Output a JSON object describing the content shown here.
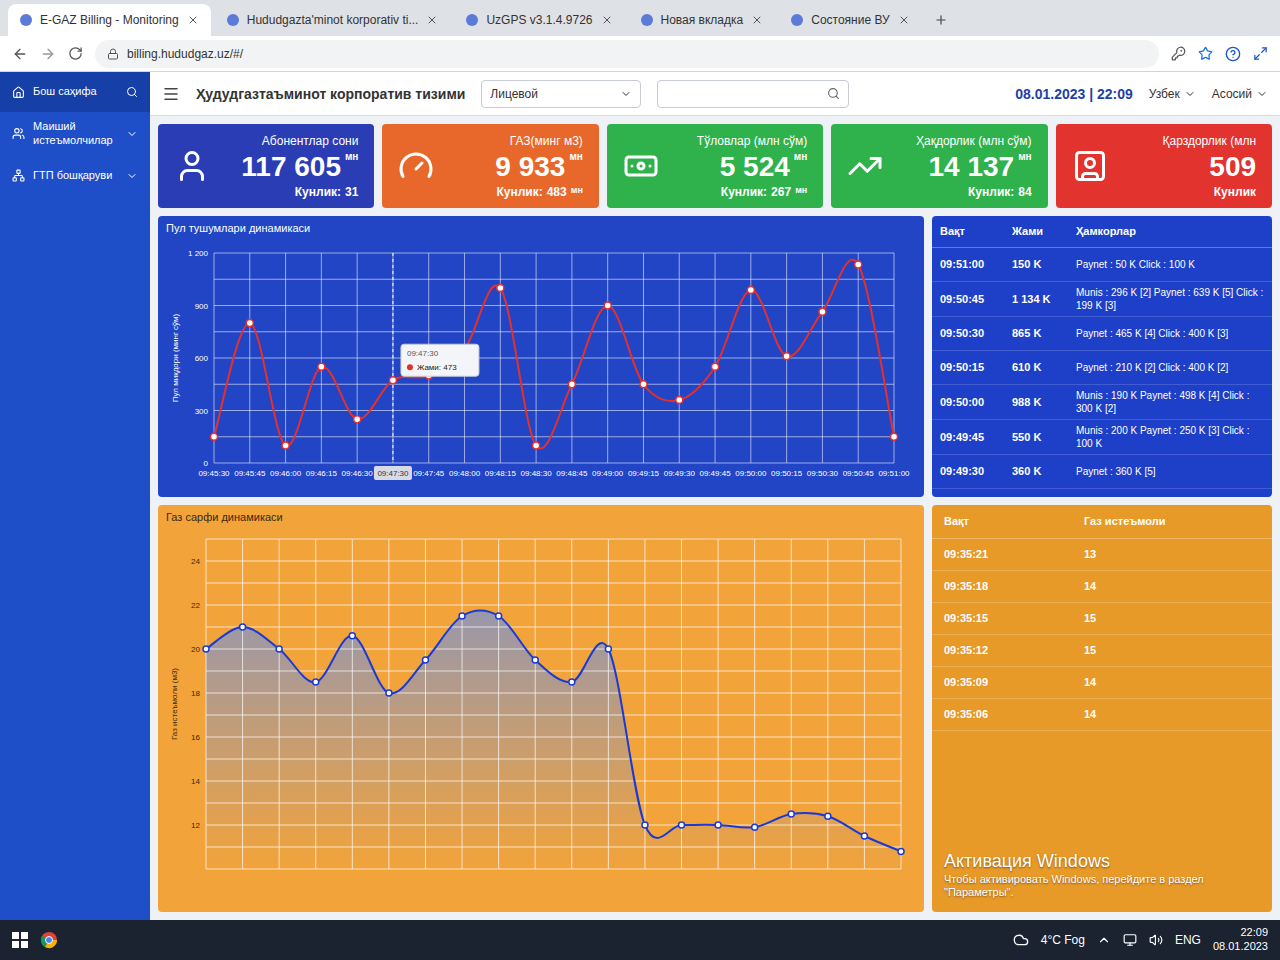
{
  "browser": {
    "tabs": [
      {
        "label": "E-GAZ Billing - Monitoring",
        "selected": true
      },
      {
        "label": "Hududgazta'minot korporativ ti...",
        "selected": false
      },
      {
        "label": "UzGPS v3.1.4.9726",
        "selected": false
      },
      {
        "label": "Новая вкладка",
        "selected": false
      },
      {
        "label": "Состояние ВУ",
        "selected": false
      }
    ],
    "address": "billing.hududgaz.uz/#/"
  },
  "app": {
    "title": "Ҳудудгазтаъминот корпоратив тизими",
    "account_select": "Лицевой",
    "datetime": "08.01.2023 | 22:09",
    "language": "Узбек",
    "menu": "Асосий"
  },
  "sidebar": {
    "items": [
      {
        "label": "Бош саҳифа",
        "selected": true,
        "expandable": false
      },
      {
        "label": "Маиший истеъмолчилар",
        "selected": false,
        "expandable": true
      },
      {
        "label": "ГТП бошқаруви",
        "selected": false,
        "expandable": true
      }
    ]
  },
  "cards": [
    {
      "title": "Абонентлар сони",
      "value": "117 605",
      "unit": "мн",
      "daily_label": "Кунлик:",
      "daily_value": "31",
      "daily_unit": "",
      "color": "#2a3db4"
    },
    {
      "title": "ГАЗ(минг м3)",
      "value": "9 933",
      "unit": "мн",
      "daily_label": "Кунлик:",
      "daily_value": "483",
      "daily_unit": "мн",
      "color": "#e8682c"
    },
    {
      "title": "Тўловлар (млн сўм)",
      "value": "5 524",
      "unit": "мн",
      "daily_label": "Кунлик:",
      "daily_value": "267",
      "daily_unit": "мн",
      "color": "#2fb14c"
    },
    {
      "title": "Ҳақдорлик (млн сўм)",
      "value": "14 137",
      "unit": "мн",
      "daily_label": "Кунлик:",
      "daily_value": "84",
      "daily_unit": "",
      "color": "#2fb14c"
    },
    {
      "title": "Қарздорлик (млн",
      "value": "509",
      "unit": "",
      "daily_label": "Кунлик",
      "daily_value": "",
      "daily_unit": "",
      "color": "#e2332f"
    }
  ],
  "payments_chart": {
    "title": "Пул тушумлари динамикаси",
    "y_axis_title": "Пул миқдори (минг сўм)",
    "y_ticks": [
      "0",
      "300",
      "600",
      "900",
      "1 200"
    ],
    "y_min": 0,
    "y_max": 1200,
    "x_labels": [
      "09:45:30",
      "09:45:45",
      "09:46:00",
      "09:46:15",
      "09:46:30",
      "09:47:30",
      "09:47:45",
      "09:48:00",
      "09:48:15",
      "09:48:30",
      "09:48:45",
      "09:49:00",
      "09:49:15",
      "09:49:30",
      "09:49:45",
      "09:50:00",
      "09:50:15",
      "09:50:30",
      "09:50:45",
      "09:51:00"
    ],
    "values": [
      150,
      800,
      100,
      550,
      250,
      473,
      500,
      650,
      1000,
      100,
      450,
      900,
      450,
      360,
      550,
      988,
      610,
      865,
      1134,
      150
    ],
    "tooltip": {
      "time": "09:47:30",
      "label": "Жами:",
      "value": "473"
    }
  },
  "payments_table": {
    "columns": [
      "Вақт",
      "Жами",
      "Ҳамкорлар"
    ],
    "rows": [
      {
        "time": "09:51:00",
        "total": "150 K",
        "partners": "Paynet : 50 K Click : 100 K"
      },
      {
        "time": "09:50:45",
        "total": "1 134 K",
        "partners": "Munis : 296 K [2] Paynet : 639 K [5] Click : 199 K [3]"
      },
      {
        "time": "09:50:30",
        "total": "865 K",
        "partners": "Paynet : 465 K [4] Click : 400 K [3]"
      },
      {
        "time": "09:50:15",
        "total": "610 K",
        "partners": "Paynet : 210 K [2] Click : 400 K [2]"
      },
      {
        "time": "09:50:00",
        "total": "988 K",
        "partners": "Munis : 190 K Paynet : 498 K [4] Click : 300 K [2]"
      },
      {
        "time": "09:49:45",
        "total": "550 K",
        "partners": "Munis : 200 K Paynet : 250 K [3] Click : 100 K"
      },
      {
        "time": "09:49:30",
        "total": "360 K",
        "partners": "Paynet : 360 K [5]"
      }
    ]
  },
  "gas_chart": {
    "title": "Газ сарфи динамикаси",
    "y_axis_title": "Газ истеъмоли (м3)",
    "y_ticks": [
      "12",
      "14",
      "16",
      "18",
      "20",
      "22",
      "24"
    ],
    "y_min": 10,
    "y_max": 25,
    "values": [
      20,
      21,
      20,
      18.5,
      20.6,
      18,
      19.5,
      21.5,
      21.5,
      19.5,
      18.5,
      20,
      12,
      12,
      12,
      11.9,
      12.5,
      12.4,
      11.5,
      10.8
    ]
  },
  "gas_table": {
    "columns": [
      "Вақт",
      "Газ истеъмоли"
    ],
    "rows": [
      {
        "time": "09:35:21",
        "value": "13"
      },
      {
        "time": "09:35:18",
        "value": "14"
      },
      {
        "time": "09:35:15",
        "value": "15"
      },
      {
        "time": "09:35:12",
        "value": "15"
      },
      {
        "time": "09:35:09",
        "value": "14"
      },
      {
        "time": "09:35:06",
        "value": "14"
      }
    ]
  },
  "watermark": {
    "title": "Активация Windows",
    "text": "Чтобы активировать Windows, перейдите в раздел \"Параметры\"."
  },
  "taskbar": {
    "weather": "4°C Fog",
    "language": "ENG",
    "time": "22:09",
    "date": "08.01.2023"
  }
}
